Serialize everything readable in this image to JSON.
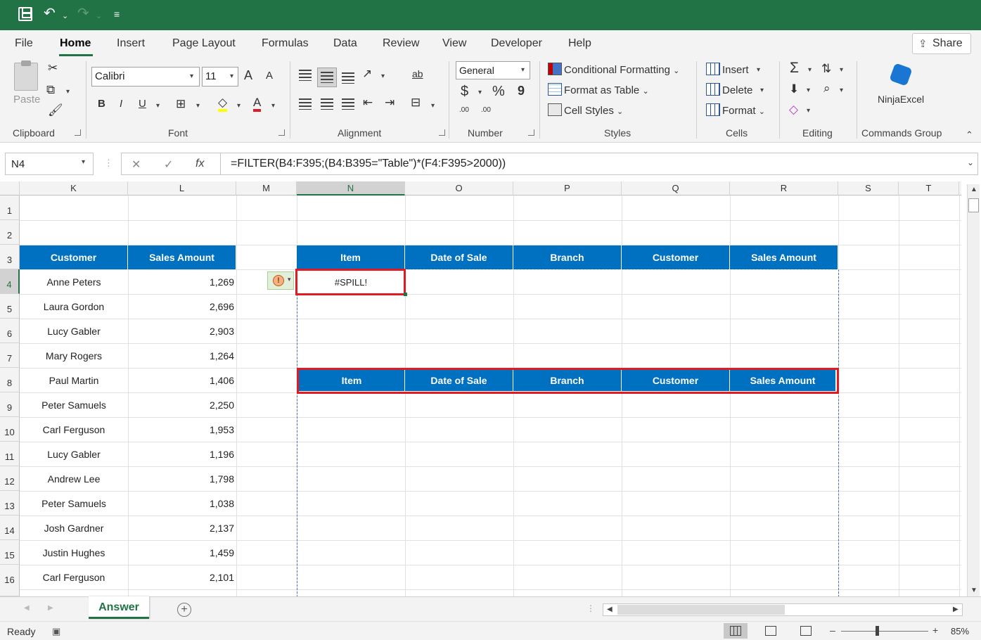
{
  "quick_access": {
    "save_icon": "save-icon",
    "undo_icon": "undo-icon",
    "redo_icon": "redo-icon"
  },
  "tabs": [
    "File",
    "Home",
    "Insert",
    "Page Layout",
    "Formulas",
    "Data",
    "Review",
    "View",
    "Developer",
    "Help"
  ],
  "active_tab": "Home",
  "share_label": "Share",
  "ribbon": {
    "clipboard": {
      "label": "Clipboard",
      "paste": "Paste"
    },
    "font": {
      "label": "Font",
      "name": "Calibri",
      "size": "11",
      "bold": "B",
      "italic": "I",
      "underline": "U",
      "grow": "A",
      "shrink": "A",
      "color": "A"
    },
    "alignment": {
      "label": "Alignment",
      "wrap": "ab"
    },
    "number": {
      "label": "Number",
      "format": "General",
      "currency": "$",
      "percent": "%",
      "comma": "9",
      "inc": ".00",
      "dec": ".00"
    },
    "styles": {
      "label": "Styles",
      "conditional": "Conditional Formatting",
      "format_table": "Format as Table",
      "cell_styles": "Cell Styles"
    },
    "cells": {
      "label": "Cells",
      "insert": "Insert",
      "delete": "Delete",
      "format": "Format"
    },
    "editing": {
      "label": "Editing",
      "sum": "Σ"
    },
    "commands": {
      "label": "Commands Group",
      "ninja": "NinjaExcel"
    }
  },
  "formula_bar": {
    "name_box": "N4",
    "cancel": "✕",
    "enter": "✓",
    "fx": "fx",
    "formula": "=FILTER(B4:F395;(B4:B395=\"Table\")*(F4:F395>2000))"
  },
  "columns": [
    "K",
    "L",
    "M",
    "N",
    "O",
    "P",
    "Q",
    "R",
    "S",
    "T"
  ],
  "rows": [
    "1",
    "2",
    "3",
    "4",
    "5",
    "6",
    "7",
    "8",
    "9",
    "10",
    "11",
    "12",
    "13",
    "14",
    "15",
    "16"
  ],
  "left_table": {
    "headers": [
      "Customer",
      "Sales Amount"
    ],
    "rows": [
      [
        "Anne Peters",
        "1,269"
      ],
      [
        "Laura Gordon",
        "2,696"
      ],
      [
        "Lucy Gabler",
        "2,903"
      ],
      [
        "Mary Rogers",
        "1,264"
      ],
      [
        "Paul Martin",
        "1,406"
      ],
      [
        "Peter Samuels",
        "2,250"
      ],
      [
        "Carl Ferguson",
        "1,953"
      ],
      [
        "Lucy Gabler",
        "1,196"
      ],
      [
        "Andrew Lee",
        "1,798"
      ],
      [
        "Peter Samuels",
        "1,038"
      ],
      [
        "Josh Gardner",
        "2,137"
      ],
      [
        "Justin Hughes",
        "1,459"
      ],
      [
        "Carl Ferguson",
        "2,101"
      ]
    ]
  },
  "filter_headers": [
    "Item",
    "Date of Sale",
    "Branch",
    "Customer",
    "Sales Amount"
  ],
  "spill_error": "#SPILL!",
  "warning_symbol": "!",
  "sheet_tab": "Answer",
  "add_sheet": "+",
  "status": "Ready",
  "zoom": "85%",
  "zoom_minus": "–",
  "zoom_plus": "+",
  "colors": {
    "excel_green": "#217346",
    "header_blue": "#0070c0",
    "highlight_red": "#e21b23"
  }
}
